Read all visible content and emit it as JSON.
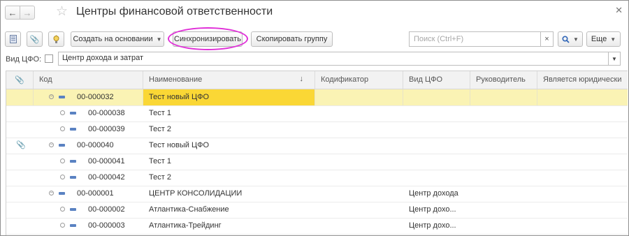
{
  "window": {
    "title": "Центры финансовой ответственности"
  },
  "toolbar": {
    "create_based_on": "Создать на основании",
    "synchronize": "Синхронизировать",
    "copy_group": "Скопировать группу",
    "search_placeholder": "Поиск (Ctrl+F)",
    "more": "Еще"
  },
  "filter": {
    "label": "Вид ЦФО:",
    "value": "Центр дохода и затрат"
  },
  "table": {
    "columns": [
      "",
      "Код",
      "Наименование",
      "Кодификатор",
      "Вид ЦФО",
      "Руководитель",
      "Является юридически"
    ],
    "rows": [
      {
        "level": 0,
        "attach": "",
        "code": "00-000032",
        "name": "Тест новый ЦФО",
        "type": "",
        "selected": true
      },
      {
        "level": 1,
        "attach": "",
        "code": "00-000038",
        "name": "Тест 1",
        "type": "",
        "selected": false
      },
      {
        "level": 1,
        "attach": "",
        "code": "00-000039",
        "name": "Тест 2",
        "type": "",
        "selected": false
      },
      {
        "level": 0,
        "attach": "📎",
        "code": "00-000040",
        "name": "Тест новый ЦФО",
        "type": "",
        "selected": false
      },
      {
        "level": 1,
        "attach": "",
        "code": "00-000041",
        "name": "Тест 1",
        "type": "",
        "selected": false
      },
      {
        "level": 1,
        "attach": "",
        "code": "00-000042",
        "name": "Тест 2",
        "type": "",
        "selected": false
      },
      {
        "level": 0,
        "attach": "",
        "code": "00-000001",
        "name": "ЦЕНТР КОНСОЛИДАЦИИ",
        "type": "Центр дохода",
        "selected": false
      },
      {
        "level": 1,
        "attach": "",
        "code": "00-000002",
        "name": "Атлантика-Снабжение",
        "type": "Центр дохо...",
        "selected": false
      },
      {
        "level": 1,
        "attach": "",
        "code": "00-000003",
        "name": "Атлантика-Трейдинг",
        "type": "Центр дохо...",
        "selected": false
      }
    ]
  }
}
